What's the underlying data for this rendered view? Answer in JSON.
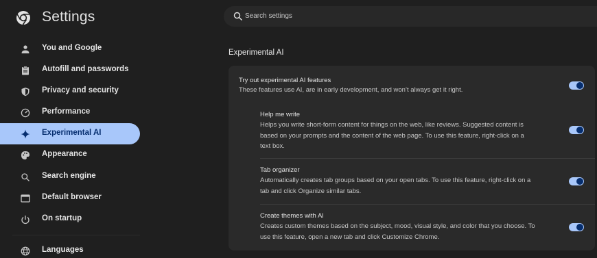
{
  "header": {
    "title": "Settings",
    "search_placeholder": "Search settings"
  },
  "sidebar": {
    "items": [
      {
        "label": "You and Google",
        "icon": "person-icon"
      },
      {
        "label": "Autofill and passwords",
        "icon": "clipboard-icon"
      },
      {
        "label": "Privacy and security",
        "icon": "shield-icon"
      },
      {
        "label": "Performance",
        "icon": "speedometer-icon"
      },
      {
        "label": "Experimental AI",
        "icon": "sparkle-icon",
        "active": true
      },
      {
        "label": "Appearance",
        "icon": "palette-icon"
      },
      {
        "label": "Search engine",
        "icon": "search-icon"
      },
      {
        "label": "Default browser",
        "icon": "browser-window-icon"
      },
      {
        "label": "On startup",
        "icon": "power-icon"
      },
      {
        "label": "Languages",
        "icon": "globe-icon"
      }
    ]
  },
  "main": {
    "section_title": "Experimental AI",
    "master": {
      "title": "Try out experimental AI features",
      "desc": "These features use AI, are in early development, and won’t always get it right.",
      "enabled": true
    },
    "features": [
      {
        "title": "Help me write",
        "desc_lines": [
          "Helps you write short-form content for things on the web, like reviews. Suggested content is",
          "based on your prompts and the content of the web page. To use this feature, right-click on a",
          "text box."
        ],
        "enabled": true
      },
      {
        "title": "Tab organizer",
        "desc_lines": [
          "Automatically creates tab groups based on your open tabs. To use this feature, right-click on a",
          "tab and click Organize similar tabs."
        ],
        "enabled": true
      },
      {
        "title": "Create themes with AI",
        "desc_lines": [
          "Creates custom themes based on the subject, mood, visual style, and color that you choose. To",
          "use this feature, open a new tab and click Customize Chrome."
        ],
        "enabled": true
      }
    ]
  },
  "colors": {
    "background": "#1f1f1f",
    "card": "#2a2a2a",
    "accent": "#a8c7fa",
    "accent_dark": "#062e6f"
  }
}
